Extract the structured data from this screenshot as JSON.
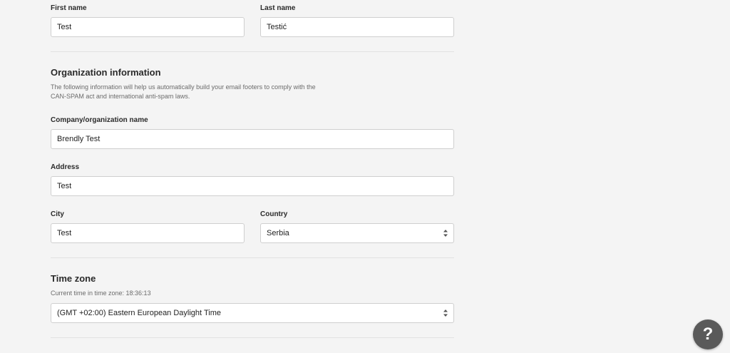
{
  "personal": {
    "first_name_label": "First name",
    "first_name_value": "Test",
    "last_name_label": "Last name",
    "last_name_value": "Testić"
  },
  "organization": {
    "title": "Organization information",
    "description": "The following information will help us automatically build your email footers to comply with the CAN-SPAM act and international anti-spam laws.",
    "company_label": "Company/organization name",
    "company_value": "Brendly Test",
    "address_label": "Address",
    "address_value": "Test",
    "city_label": "City",
    "city_value": "Test",
    "country_label": "Country",
    "country_value": "Serbia"
  },
  "timezone": {
    "title": "Time zone",
    "current_time": "Current time in time zone: 18:36:13",
    "selected": "(GMT +02:00) Eastern European Daylight Time"
  },
  "help": {
    "label": "?"
  }
}
